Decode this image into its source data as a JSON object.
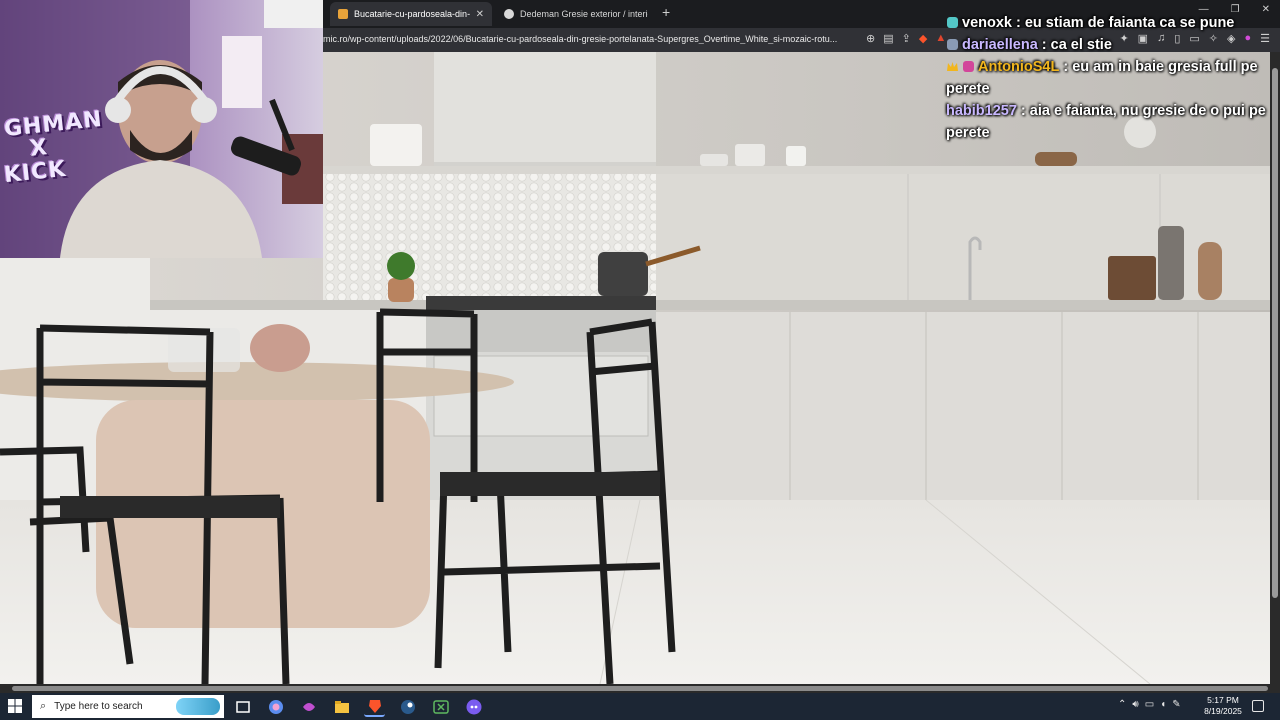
{
  "browser": {
    "tabs": [
      {
        "title": "Bucatarie-cu-pardoseala-din-gresie-portelanata",
        "active": true
      },
      {
        "title": "Dedeman Gresie exterior / interior pe",
        "active": false
      }
    ],
    "new_tab": "+",
    "url": "mic.ro/wp-content/uploads/2022/06/Bucatarie-cu-pardoseala-din-gresie-portelanata-Supergres_Overtime_White_si-mozaic-rotu..."
  },
  "overlay": {
    "cam_text_lines": [
      "GHMAN",
      "X",
      "KICK"
    ]
  },
  "chat": {
    "messages": [
      {
        "user": "venoxk",
        "user_color": "#ffffff",
        "badge_color": "#53c7c7",
        "text": "eu stiam de faianta ca se pune"
      },
      {
        "user": "dariaellena",
        "user_color": "#c9b8ff",
        "badge_color": "#8a9bb5",
        "text": "ca el stie"
      },
      {
        "user": "AntonioS4L",
        "user_color": "#f2b61d",
        "badge_color": "#d2469a",
        "text": "eu am in baie gresia full pe perete"
      },
      {
        "user": "habib1257",
        "user_color": "#c9b8ff",
        "badge_color": "",
        "text": "aia e faianta, nu gresie de o pui pe perete"
      }
    ]
  },
  "taskbar": {
    "search_placeholder": "Type here to search",
    "time": "5:17 PM",
    "date": "8/19/2025"
  },
  "colors": {
    "taskbar_bg": "#1c2634",
    "chrome_bg": "#1b1c1f",
    "toolbar_bg": "#303136"
  }
}
